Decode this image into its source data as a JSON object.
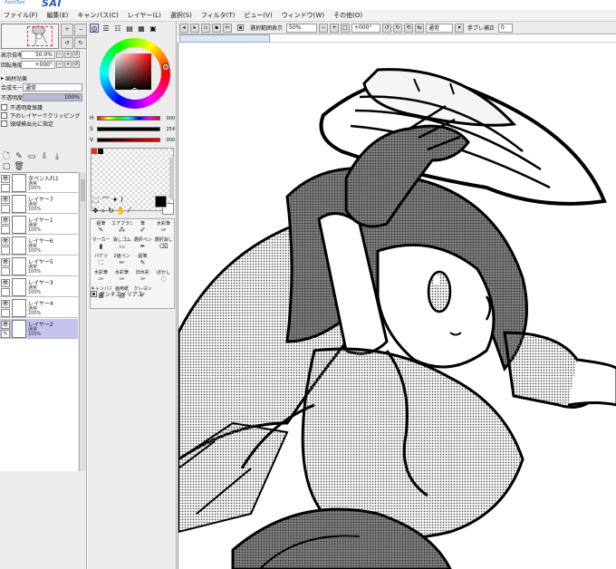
{
  "app": {
    "logo_small": "PaintTool",
    "logo_big": "SAI"
  },
  "menu": [
    "ファイル(F)",
    "編集(E)",
    "キャンバス(C)",
    "レイヤー(L)",
    "選択(S)",
    "フィルタ(T)",
    "ビュー(V)",
    "ウィンドウ(W)",
    "その他(O)"
  ],
  "navigator": {
    "zoom_label": "表示倍率",
    "zoom_value": "50.0%",
    "angle_label": "回転角度",
    "angle_value": "+000°"
  },
  "layer_props": {
    "effects_label": "画材効果",
    "blend_label": "合成モード",
    "blend_value": "通常",
    "opacity_label": "不透明度",
    "opacity_value": "100%",
    "protect_label": "不透明度保護",
    "clip_label": "下のレイヤーでクリッピング",
    "reference_label": "領域検出元に指定"
  },
  "layers": [
    {
      "name": "タペン入れ1",
      "mode": "通常",
      "opacity": "100%",
      "selected": false
    },
    {
      "name": "レイヤー7",
      "mode": "通常",
      "opacity": "100%",
      "selected": false
    },
    {
      "name": "レイヤー1",
      "mode": "通常",
      "opacity": "100%",
      "selected": false
    },
    {
      "name": "レイヤー6",
      "mode": "通常",
      "opacity": "100%",
      "selected": false
    },
    {
      "name": "レイヤー5",
      "mode": "通常",
      "opacity": "100%",
      "selected": false
    },
    {
      "name": "レイヤー3",
      "mode": "通常",
      "opacity": "100%",
      "selected": false
    },
    {
      "name": "レイヤー4",
      "mode": "通常",
      "opacity": "100%",
      "selected": false
    },
    {
      "name": "レイヤー2",
      "mode": "通常",
      "opacity": "100%",
      "selected": true
    }
  ],
  "color": {
    "sliders": [
      {
        "label": "H",
        "value": "000"
      },
      {
        "label": "S",
        "value": "254"
      },
      {
        "label": "V",
        "value": "000"
      }
    ],
    "foreground": "#000000",
    "background": "#ffffff"
  },
  "tools": [
    {
      "label": "鉛筆",
      "icon": "pencil-icon"
    },
    {
      "label": "エアブラシ",
      "icon": "airbrush-icon"
    },
    {
      "label": "筆",
      "icon": "brush-icon"
    },
    {
      "label": "水彩筆",
      "icon": "watercolor-icon"
    },
    {
      "label": "マーカー",
      "icon": "marker-icon"
    },
    {
      "label": "消しゴム",
      "icon": "eraser-icon"
    },
    {
      "label": "選択ペン",
      "icon": "select-pen-icon"
    },
    {
      "label": "選択消し",
      "icon": "select-erase-icon"
    },
    {
      "label": "バケツ",
      "icon": "bucket-icon"
    },
    {
      "label": "2値ペン",
      "icon": "binary-pen-icon"
    },
    {
      "label": "鉛筆",
      "icon": "pencil-icon"
    },
    {
      "label": "",
      "icon": "blank"
    },
    {
      "label": "水彩筆",
      "icon": "watercolor-icon"
    },
    {
      "label": "水彩筆",
      "icon": "watercolor-icon"
    },
    {
      "label": "旧水彩",
      "icon": "old-watercolor-icon"
    },
    {
      "label": "ぼかし",
      "icon": "blur-icon"
    },
    {
      "label": "キャンバス",
      "icon": "canvas-icon"
    },
    {
      "label": "画用紙",
      "icon": "paper-icon"
    },
    {
      "label": "クレヨン",
      "icon": "crayon-icon"
    },
    {
      "label": "",
      "icon": "blank"
    }
  ],
  "antialias_label": "アンチエイリアス",
  "toolbar": {
    "selection_label": "選択範囲表示",
    "zoom_value": "50%",
    "angle_value": "+000°",
    "mode_value": "通常",
    "stabilizer_label": "手ブレ補正",
    "stabilizer_value": "0"
  }
}
